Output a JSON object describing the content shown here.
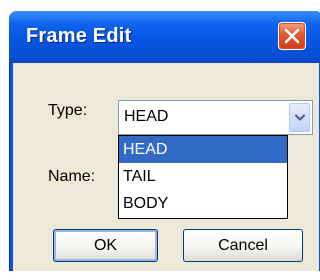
{
  "window": {
    "title": "Frame Edit",
    "close_icon": "close-x-icon"
  },
  "form": {
    "type_label": "Type:",
    "name_label": "Name:",
    "type_select": {
      "value": "HEAD",
      "arrow_icon": "chevron-down-icon",
      "options": [
        "HEAD",
        "TAIL",
        "BODY"
      ],
      "highlighted": "HEAD"
    }
  },
  "buttons": {
    "ok": "OK",
    "cancel": "Cancel"
  },
  "colors": {
    "title_bar": "#0a54e2",
    "close_button": "#e3582f",
    "selection": "#316ac5",
    "dialog_face": "#ece9d8"
  }
}
